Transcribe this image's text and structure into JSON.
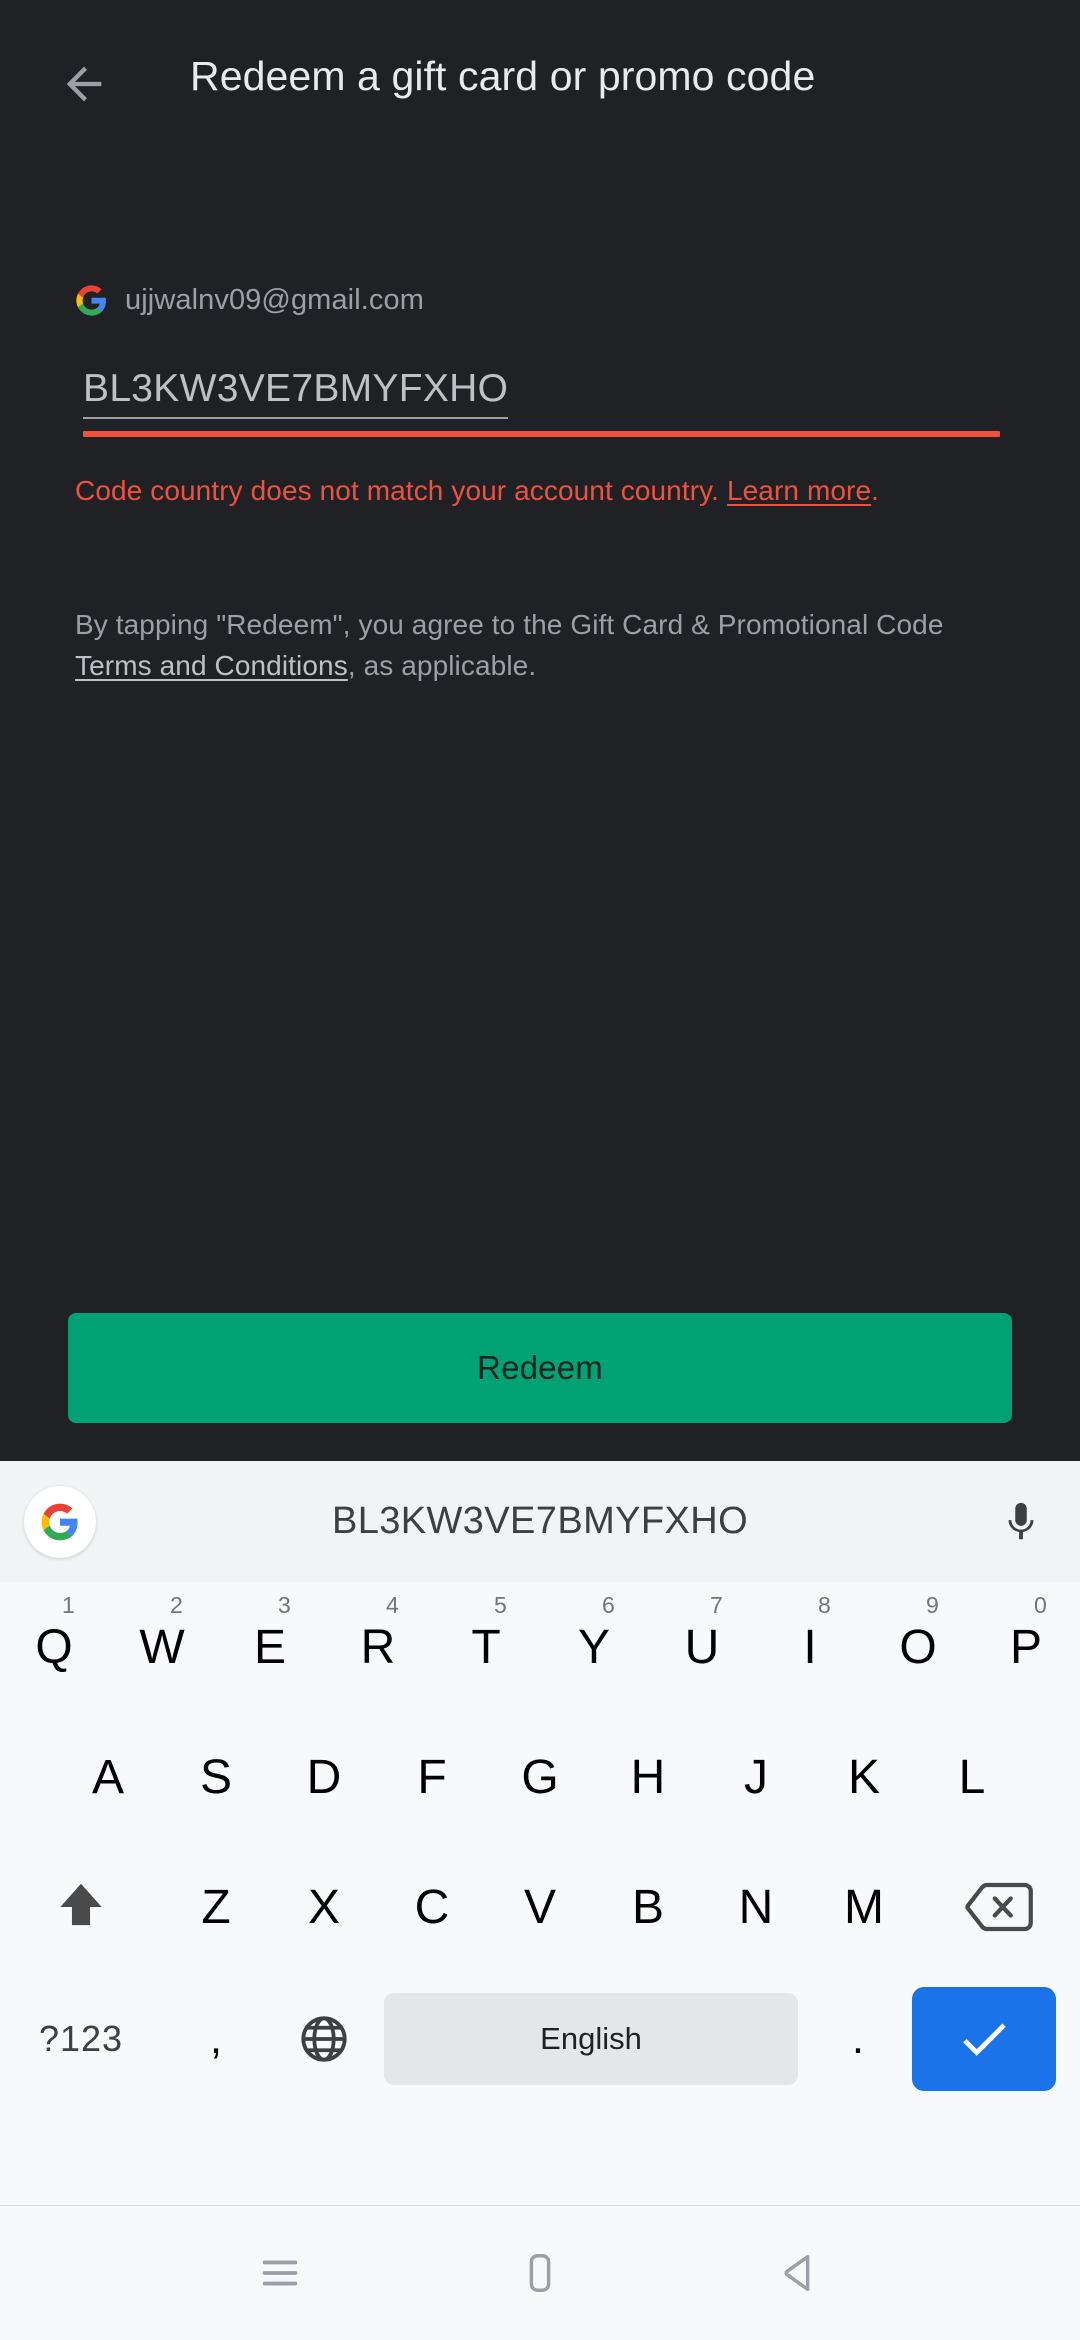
{
  "appbar": {
    "back_icon": "back-arrow-icon",
    "title": "Redeem a gift card or promo code"
  },
  "account": {
    "logo_icon": "google-g-icon",
    "email": "ujjwalnv09@gmail.com"
  },
  "code_field": {
    "value": "BL3KW3VE7BMYFXHO",
    "error_state": true
  },
  "error": {
    "text": "Code country does not match your account country. ",
    "link": "Learn more",
    "suffix": "."
  },
  "terms": {
    "prefix": "By tapping \"Redeem\", you agree to the Gift Card & Promotional Code ",
    "link": "Terms and Conditions",
    "suffix": ", as applicable."
  },
  "actions": {
    "redeem_label": "Redeem"
  },
  "keyboard": {
    "suggestion_bar": {
      "logo_icon": "google-g-icon",
      "suggestion": "BL3KW3VE7BMYFXHO",
      "mic_icon": "microphone-icon"
    },
    "row1": [
      {
        "label": "Q",
        "hint": "1"
      },
      {
        "label": "W",
        "hint": "2"
      },
      {
        "label": "E",
        "hint": "3"
      },
      {
        "label": "R",
        "hint": "4"
      },
      {
        "label": "T",
        "hint": "5"
      },
      {
        "label": "Y",
        "hint": "6"
      },
      {
        "label": "U",
        "hint": "7"
      },
      {
        "label": "I",
        "hint": "8"
      },
      {
        "label": "O",
        "hint": "9"
      },
      {
        "label": "P",
        "hint": "0"
      }
    ],
    "row2": [
      "A",
      "S",
      "D",
      "F",
      "G",
      "H",
      "J",
      "K",
      "L"
    ],
    "row3": {
      "shift_icon": "shift-up-arrow-icon",
      "letters": [
        "Z",
        "X",
        "C",
        "V",
        "B",
        "N",
        "M"
      ],
      "delete_icon": "backspace-icon"
    },
    "row4": {
      "symbols_label": "?123",
      "comma_label": ",",
      "globe_icon": "globe-language-icon",
      "space_label": "English",
      "period_label": ".",
      "enter_icon": "checkmark-enter-icon"
    }
  },
  "navbar": {
    "recents_icon": "recents-menu-icon",
    "home_icon": "home-square-icon",
    "back_icon": "back-triangle-icon"
  },
  "colors": {
    "app_background": "#202124",
    "title_text": "#e8eaed",
    "secondary_text": "#9aa0a6",
    "error_red": "#f0513e",
    "redeem_green": "#00a173",
    "keyboard_background": "#f8f9fa",
    "suggestion_background": "#f1f3f4",
    "enter_blue": "#1a73e8",
    "spacebar_gray": "#e4e6e8"
  }
}
